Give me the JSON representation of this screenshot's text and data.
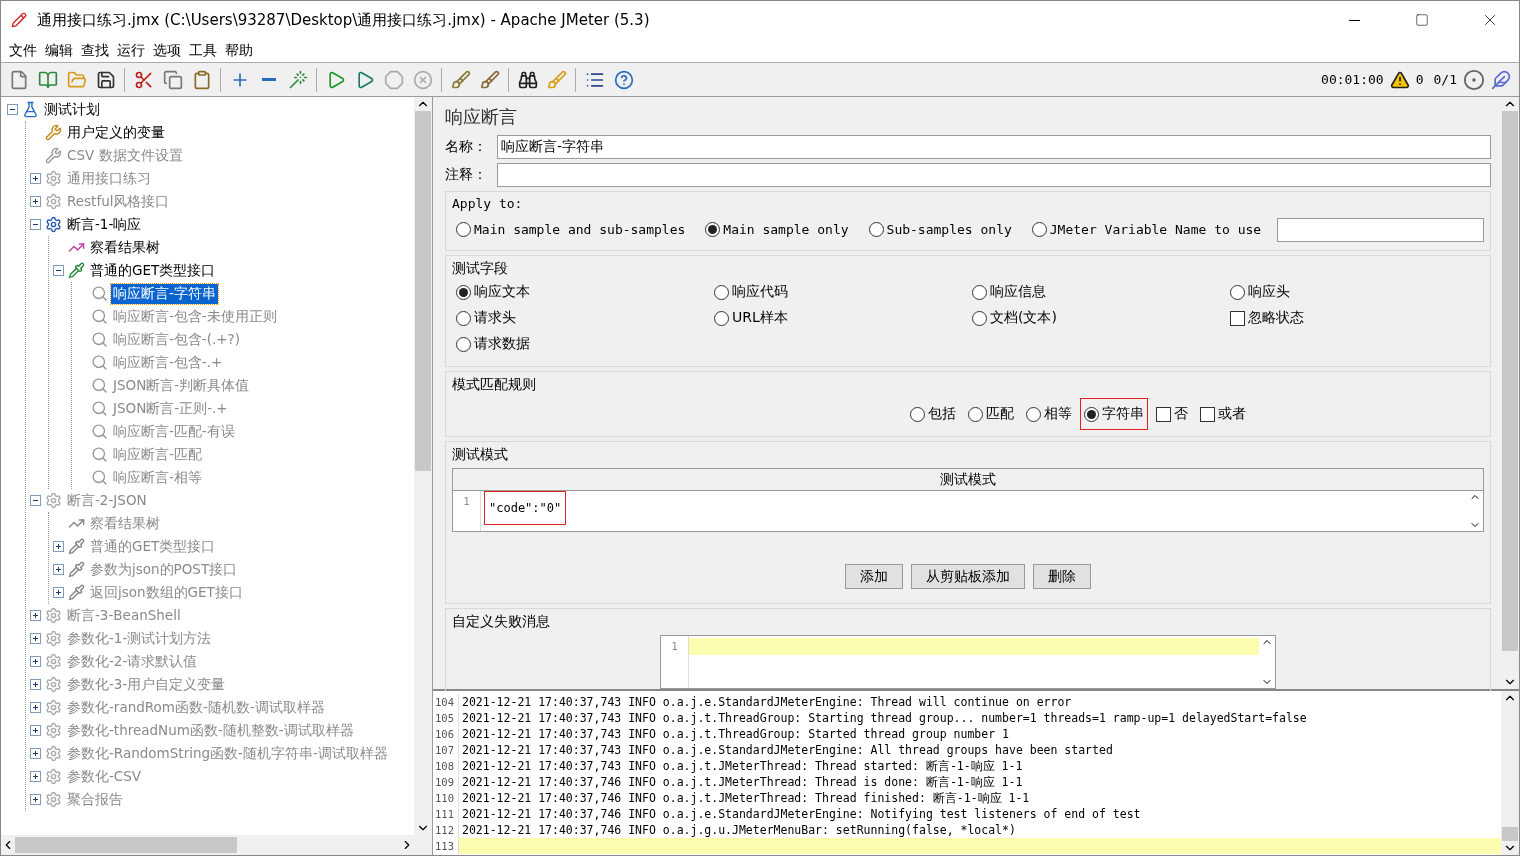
{
  "window": {
    "title": "通用接口练习.jmx (C:\\Users\\93287\\Desktop\\通用接口练习.jmx) - Apache JMeter (5.3)"
  },
  "menu": [
    "文件",
    "编辑",
    "查找",
    "运行",
    "选项",
    "工具",
    "帮助"
  ],
  "toolbar": {
    "timer": "00:01:00",
    "warnings": "0",
    "threads": "0/1"
  },
  "tree": {
    "nodes": [
      {
        "label": "测试计划",
        "kind": "plan",
        "disabled": false,
        "selected": false,
        "expanded": true,
        "children": [
          {
            "label": "用户定义的变量",
            "kind": "config",
            "disabled": false,
            "selected": false
          },
          {
            "label": "CSV 数据文件设置",
            "kind": "config",
            "disabled": true,
            "selected": false
          },
          {
            "label": "通用接口练习",
            "kind": "group",
            "disabled": true,
            "selected": false,
            "expanded": false
          },
          {
            "label": "Restful风格接口",
            "kind": "group",
            "disabled": true,
            "selected": false,
            "expanded": false
          },
          {
            "label": "断言-1-响应",
            "kind": "group",
            "disabled": false,
            "selected": false,
            "expanded": true,
            "children": [
              {
                "label": "察看结果树",
                "kind": "listener",
                "disabled": false,
                "selected": false
              },
              {
                "label": "普通的GET类型接口",
                "kind": "sampler",
                "disabled": false,
                "selected": false,
                "expanded": true,
                "children": [
                  {
                    "label": "响应断言-字符串",
                    "kind": "assertion",
                    "disabled": false,
                    "selected": true
                  },
                  {
                    "label": "响应断言-包含-未使用正则",
                    "kind": "assertion",
                    "disabled": true,
                    "selected": false
                  },
                  {
                    "label": "响应断言-包含-(.+?)",
                    "kind": "assertion",
                    "disabled": true,
                    "selected": false
                  },
                  {
                    "label": "响应断言-包含-.+",
                    "kind": "assertion",
                    "disabled": true,
                    "selected": false
                  },
                  {
                    "label": "JSON断言-判断具体值",
                    "kind": "assertion",
                    "disabled": true,
                    "selected": false
                  },
                  {
                    "label": "JSON断言-正则-.+",
                    "kind": "assertion",
                    "disabled": true,
                    "selected": false
                  },
                  {
                    "label": "响应断言-匹配-有误",
                    "kind": "assertion",
                    "disabled": true,
                    "selected": false
                  },
                  {
                    "label": "响应断言-匹配",
                    "kind": "assertion",
                    "disabled": true,
                    "selected": false
                  },
                  {
                    "label": "响应断言-相等",
                    "kind": "assertion",
                    "disabled": true,
                    "selected": false
                  }
                ]
              }
            ]
          },
          {
            "label": "断言-2-JSON",
            "kind": "group",
            "disabled": true,
            "selected": false,
            "expanded": true,
            "children": [
              {
                "label": "察看结果树",
                "kind": "listener",
                "disabled": true,
                "selected": false
              },
              {
                "label": "普通的GET类型接口",
                "kind": "sampler",
                "disabled": true,
                "selected": false,
                "expanded": false
              },
              {
                "label": "参数为json的POST接口",
                "kind": "sampler",
                "disabled": true,
                "selected": false,
                "expanded": false
              },
              {
                "label": "返回json数组的GET接口",
                "kind": "sampler",
                "disabled": true,
                "selected": false,
                "expanded": false
              }
            ]
          },
          {
            "label": "断言-3-BeanShell",
            "kind": "group",
            "disabled": true,
            "selected": false,
            "expanded": false
          },
          {
            "label": "参数化-1-测试计划方法",
            "kind": "group",
            "disabled": true,
            "selected": false,
            "expanded": false
          },
          {
            "label": "参数化-2-请求默认值",
            "kind": "group",
            "disabled": true,
            "selected": false,
            "expanded": false
          },
          {
            "label": "参数化-3-用户自定义变量",
            "kind": "group",
            "disabled": true,
            "selected": false,
            "expanded": false
          },
          {
            "label": "参数化-randRom函数-随机数-调试取样器",
            "kind": "group",
            "disabled": true,
            "selected": false,
            "expanded": false
          },
          {
            "label": "参数化-threadNum函数-随机整数-调试取样器",
            "kind": "group",
            "disabled": true,
            "selected": false,
            "expanded": false
          },
          {
            "label": "参数化-RandomString函数-随机字符串-调试取样器",
            "kind": "group",
            "disabled": true,
            "selected": false,
            "expanded": false
          },
          {
            "label": "参数化-CSV",
            "kind": "group",
            "disabled": true,
            "selected": false,
            "expanded": false
          },
          {
            "label": "聚合报告",
            "kind": "group",
            "disabled": true,
            "selected": false,
            "expanded": false
          }
        ]
      }
    ]
  },
  "panel": {
    "heading": "响应断言",
    "name_label": "名称：",
    "name_value": "响应断言-字符串",
    "comment_label": "注释：",
    "apply_to": {
      "legend": "Apply to:",
      "options": [
        {
          "label": "Main sample and sub-samples",
          "selected": false
        },
        {
          "label": "Main sample only",
          "selected": true
        },
        {
          "label": "Sub-samples only",
          "selected": false
        },
        {
          "label": "JMeter Variable Name to use",
          "selected": false
        }
      ]
    },
    "test_field": {
      "legend": "测试字段",
      "options": [
        {
          "label": "响应文本",
          "kind": "radio",
          "selected": true
        },
        {
          "label": "响应代码",
          "kind": "radio",
          "selected": false
        },
        {
          "label": "响应信息",
          "kind": "radio",
          "selected": false
        },
        {
          "label": "响应头",
          "kind": "radio",
          "selected": false
        },
        {
          "label": "请求头",
          "kind": "radio",
          "selected": false
        },
        {
          "label": "URL样本",
          "kind": "radio",
          "selected": false
        },
        {
          "label": "文档(文本)",
          "kind": "radio",
          "selected": false
        },
        {
          "label": "忽略状态",
          "kind": "checkbox",
          "checked": false
        },
        {
          "label": "请求数据",
          "kind": "radio",
          "selected": false
        }
      ]
    },
    "pattern_rules": {
      "legend": "模式匹配规则",
      "options": [
        {
          "label": "包括",
          "kind": "radio",
          "selected": false,
          "highlighted": false
        },
        {
          "label": "匹配",
          "kind": "radio",
          "selected": false,
          "highlighted": false
        },
        {
          "label": "相等",
          "kind": "radio",
          "selected": false,
          "highlighted": false
        },
        {
          "label": "字符串",
          "kind": "radio",
          "selected": true,
          "highlighted": true
        },
        {
          "label": "否",
          "kind": "checkbox",
          "checked": false,
          "highlighted": false
        },
        {
          "label": "或者",
          "kind": "checkbox",
          "checked": false,
          "highlighted": false
        }
      ]
    },
    "test_patterns": {
      "legend": "测试模式",
      "column": "测试模式",
      "rows": [
        {
          "line": "1",
          "text": "\"code\":\"0\"",
          "highlighted": true
        }
      ]
    },
    "buttons": [
      "添加",
      "从剪贴板添加",
      "删除"
    ],
    "failure_message": {
      "legend": "自定义失败消息",
      "lines": [
        {
          "line": "1",
          "current": true
        }
      ]
    }
  },
  "log": {
    "lines": [
      {
        "line": "104",
        "text": "2021-12-21 17:40:37,743 INFO o.a.j.e.StandardJMeterEngine: Thread will continue on error",
        "current": false
      },
      {
        "line": "105",
        "text": "2021-12-21 17:40:37,743 INFO o.a.j.t.ThreadGroup: Starting thread group... number=1 threads=1 ramp-up=1 delayedStart=false",
        "current": false
      },
      {
        "line": "106",
        "text": "2021-12-21 17:40:37,743 INFO o.a.j.t.ThreadGroup: Started thread group number 1",
        "current": false
      },
      {
        "line": "107",
        "text": "2021-12-21 17:40:37,743 INFO o.a.j.e.StandardJMeterEngine: All thread groups have been started",
        "current": false
      },
      {
        "line": "108",
        "text": "2021-12-21 17:40:37,743 INFO o.a.j.t.JMeterThread: Thread started: 断言-1-响应 1-1",
        "current": false
      },
      {
        "line": "109",
        "text": "2021-12-21 17:40:37,746 INFO o.a.j.t.JMeterThread: Thread is done: 断言-1-响应 1-1",
        "current": false
      },
      {
        "line": "110",
        "text": "2021-12-21 17:40:37,746 INFO o.a.j.t.JMeterThread: Thread finished: 断言-1-响应 1-1",
        "current": false
      },
      {
        "line": "111",
        "text": "2021-12-21 17:40:37,746 INFO o.a.j.e.StandardJMeterEngine: Notifying test listeners of end of test",
        "current": false
      },
      {
        "line": "112",
        "text": "2021-12-21 17:40:37,746 INFO o.a.j.g.u.JMeterMenuBar: setRunning(false, *local*)",
        "current": false
      },
      {
        "line": "113",
        "current": true
      }
    ]
  }
}
